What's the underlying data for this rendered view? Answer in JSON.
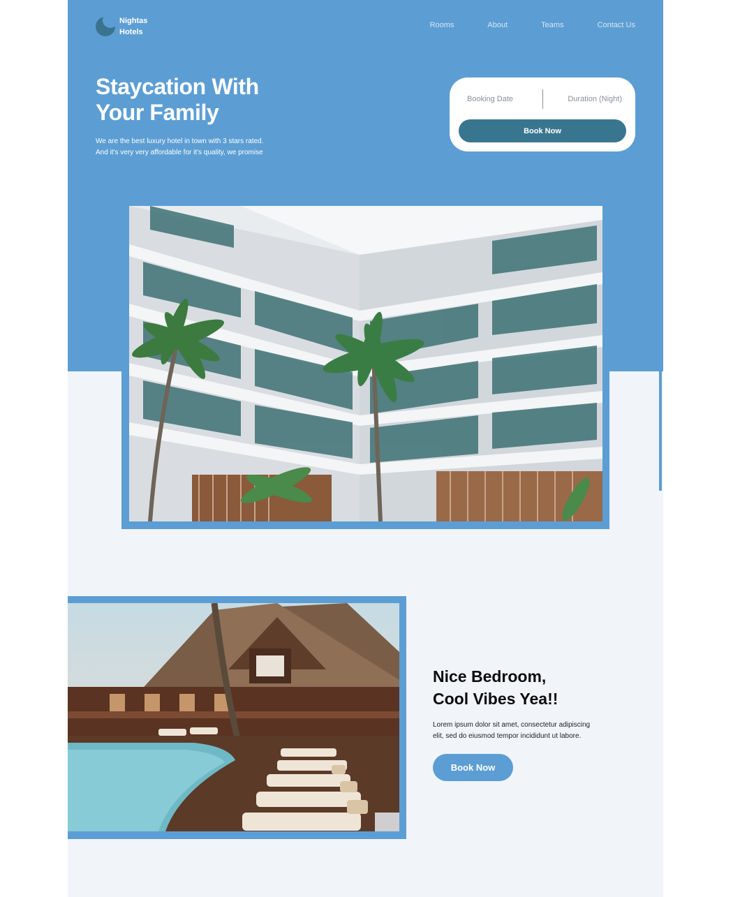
{
  "brand": {
    "line1": "Nightas",
    "line2": "Hotels"
  },
  "nav": {
    "items": [
      {
        "label": "Rooms"
      },
      {
        "label": "About"
      },
      {
        "label": "Teams"
      },
      {
        "label": "Contact Us"
      }
    ]
  },
  "hero": {
    "title_line1": "Staycation With",
    "title_line2": "Your Family",
    "desc_line1": "We are the best luxury hotel in town with 3 stars rated.",
    "desc_line2": "And it's very very affordable for it's quality, we promise"
  },
  "booking": {
    "date_placeholder": "Booking Date",
    "duration_placeholder": "Duration (Night)",
    "button_label": "Book Now"
  },
  "feature": {
    "title_line1": "Nice Bedroom,",
    "title_line2": "Cool Vibes Yea!!",
    "desc_line1": "Lorem ipsum dolor sit amet, consectetur adipiscing",
    "desc_line2": "elit, sed do eiusmod tempor incididunt ut labore.",
    "button_label": "Book Now"
  },
  "colors": {
    "primary": "#5c9ed3",
    "dark_teal": "#387690",
    "background": "#f1f4f9"
  }
}
